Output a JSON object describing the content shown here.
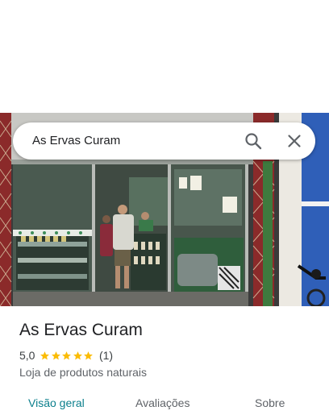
{
  "search": {
    "query": "As Ervas Curam"
  },
  "photo": {
    "subject": "storefront-photo",
    "shop_signs": [
      "",
      "",
      ""
    ]
  },
  "place": {
    "name": "As Ervas Curam",
    "rating": "5,0",
    "stars": 5,
    "review_count": "(1)",
    "category": "Loja de produtos naturais"
  },
  "tabs": [
    {
      "label": "Visão geral",
      "active": true
    },
    {
      "label": "Avaliações",
      "active": false
    },
    {
      "label": "Sobre",
      "active": false
    }
  ],
  "colors": {
    "accent": "#0b7f8c",
    "star": "#fbbc04",
    "title_text": "#202124",
    "secondary_text": "#5f6368"
  },
  "icons": {
    "search": "search-icon",
    "close": "close-icon",
    "star": "star-icon"
  }
}
